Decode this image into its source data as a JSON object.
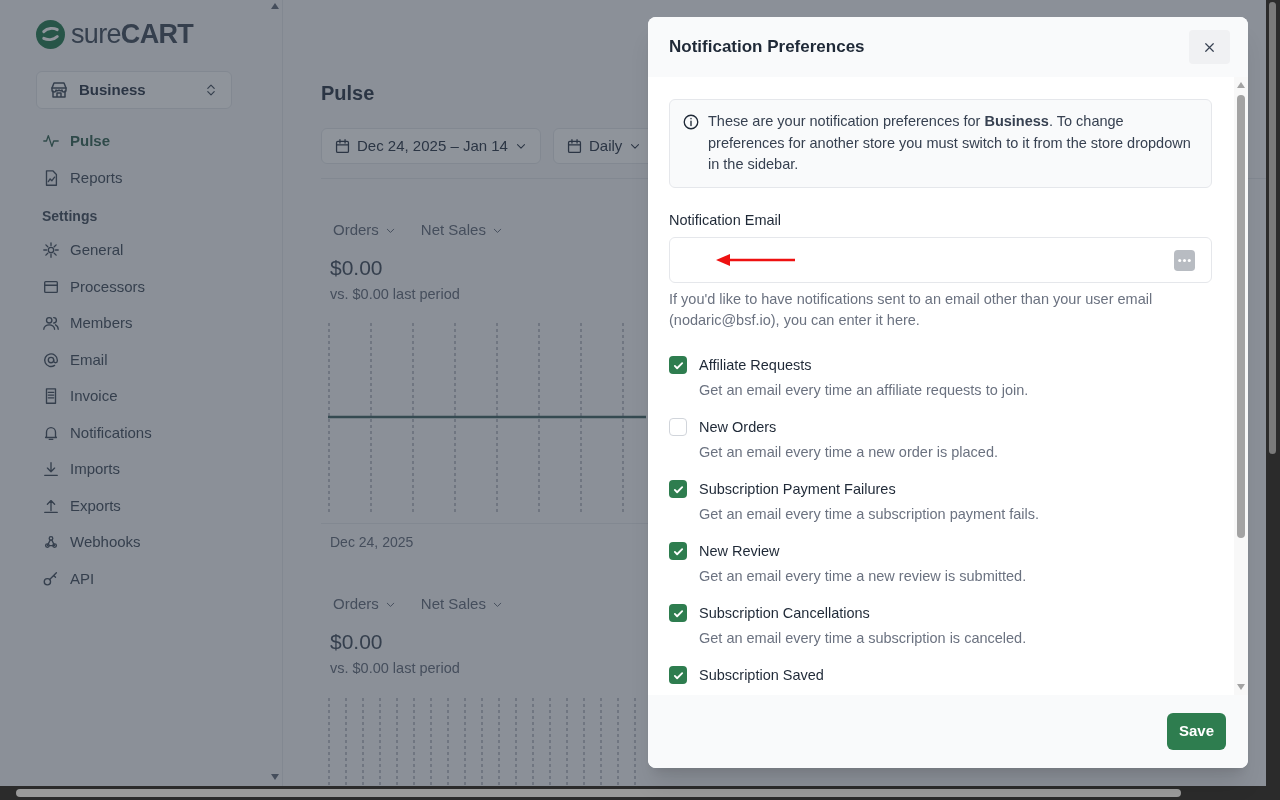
{
  "logo": {
    "text": "sure**CART**"
  },
  "store_switcher": {
    "label": "Business"
  },
  "nav": [
    {
      "label": "Pulse",
      "selected": true
    },
    {
      "label": "Reports",
      "selected": false
    }
  ],
  "settings": {
    "heading": "Settings",
    "items": [
      {
        "label": "General"
      },
      {
        "label": "Processors"
      },
      {
        "label": "Members"
      },
      {
        "label": "Email"
      },
      {
        "label": "Invoice"
      },
      {
        "label": "Notifications"
      },
      {
        "label": "Imports"
      },
      {
        "label": "Exports"
      },
      {
        "label": "Webhooks"
      },
      {
        "label": "API"
      }
    ]
  },
  "main": {
    "title": "Pulse",
    "date_range": "Dec 24, 2025 – Jan 14",
    "interval": "Daily",
    "panels": [
      {
        "metric_menus": [
          "Orders",
          "Net Sales"
        ],
        "value": "$0.00",
        "comparison": "vs. $0.00 last period",
        "x_label": "Dec 24, 2025"
      },
      {
        "metric_menus": [
          "Orders",
          "Net Sales"
        ],
        "value": "$0.00",
        "comparison": "vs. $0.00 last period"
      }
    ]
  },
  "modal": {
    "title": "Notification Preferences",
    "notice": "These are your notification preferences for **Business**. To change preferences for another store you must switch to it from the store dropdown in the sidebar.",
    "email_field": {
      "label": "Notification Email",
      "help": "If you'd like to have notifications sent to an email other than your user email (nodaric@bsf.io), you can enter it here."
    },
    "preferences": [
      {
        "label": "Affiliate Requests",
        "description": "Get an email every time an affiliate requests to join.",
        "checked": true
      },
      {
        "label": "New Orders",
        "description": "Get an email every time a new order is placed.",
        "checked": false
      },
      {
        "label": "Subscription Payment Failures",
        "description": "Get an email every time a subscription payment fails.",
        "checked": true
      },
      {
        "label": "New Review",
        "description": "Get an email every time a new review is submitted.",
        "checked": true
      },
      {
        "label": "Subscription Cancellations",
        "description": "Get an email every time a subscription is canceled.",
        "checked": true
      },
      {
        "label": "Subscription Saved",
        "checked": true
      }
    ],
    "save_button": "Save"
  }
}
